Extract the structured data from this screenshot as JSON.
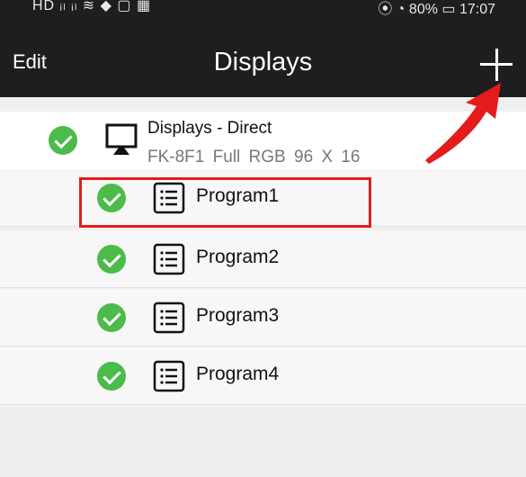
{
  "status_bar": {
    "left_icons": "HD ᵢₗ ᵢₗ ≋ ◆ ▢ ▦",
    "right_text": "⦿ ◔ 80% ▭ 17:07"
  },
  "nav": {
    "edit_label": "Edit",
    "title": "Displays",
    "add_icon": "plus-icon"
  },
  "device": {
    "name": "Displays - Direct",
    "model": "FK-8F1",
    "color_mode": "Full RGB",
    "resolution": "96 X 16",
    "status": "ok"
  },
  "programs": [
    {
      "label": "Program1",
      "status": "ok",
      "highlighted": true
    },
    {
      "label": "Program2",
      "status": "ok"
    },
    {
      "label": "Program3",
      "status": "ok"
    },
    {
      "label": "Program4",
      "status": "ok"
    }
  ],
  "colors": {
    "nav_bg": "#1e1e1e",
    "check_green": "#4cbb4a",
    "annotation_red": "#e31b1b"
  }
}
